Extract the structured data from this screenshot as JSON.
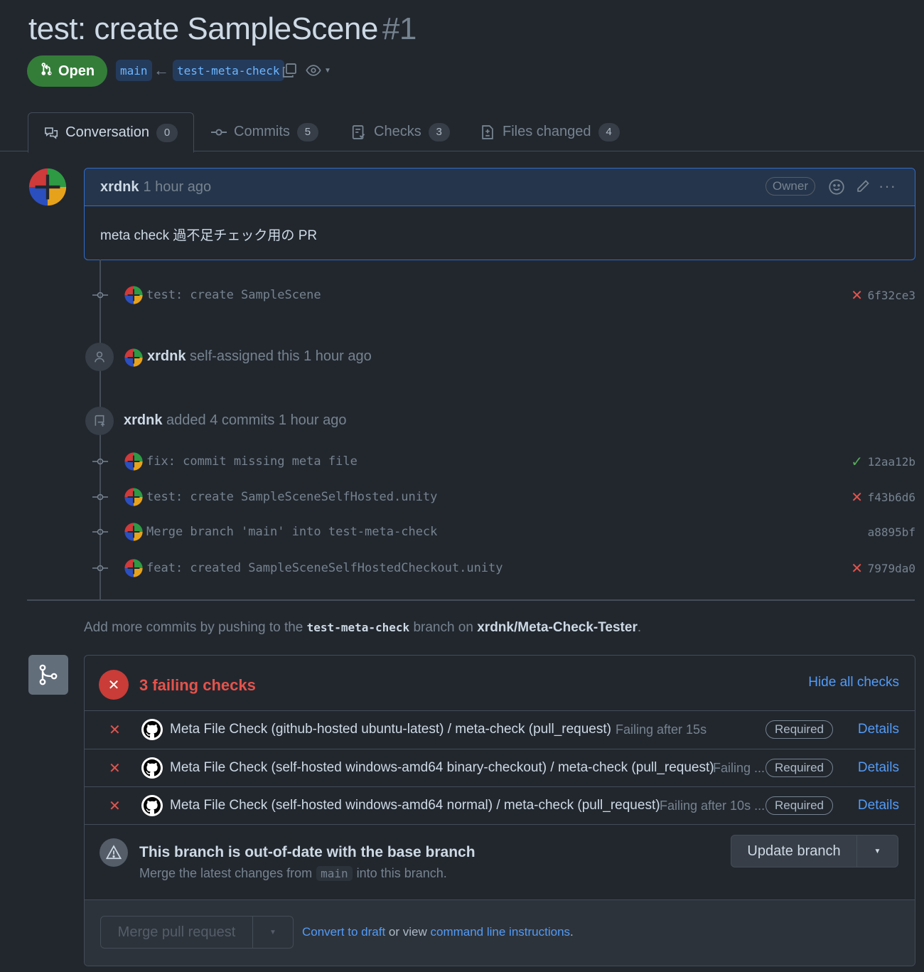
{
  "pr": {
    "title": "test: create SampleScene",
    "number": "#1",
    "state": "Open",
    "base_branch": "main",
    "head_branch": "test-meta-check"
  },
  "tabs": [
    {
      "label": "Conversation",
      "count": "0"
    },
    {
      "label": "Commits",
      "count": "5"
    },
    {
      "label": "Checks",
      "count": "3"
    },
    {
      "label": "Files changed",
      "count": "4"
    }
  ],
  "comment": {
    "author": "xrdnk",
    "time": "1 hour ago",
    "badge": "Owner",
    "body": "meta check 過不足チェック用の PR"
  },
  "timeline": {
    "first_commit": {
      "message": "test: create SampleScene",
      "sha": "6f32ce3",
      "status": "fail"
    },
    "self_assign": {
      "user": "xrdnk",
      "text": "self-assigned this 1 hour ago"
    },
    "added": {
      "user": "xrdnk",
      "text": "added 4 commits 1 hour ago"
    },
    "commits": [
      {
        "message": "fix: commit missing meta file",
        "sha": "12aa12b",
        "status": "ok"
      },
      {
        "message": "test: create SampleSceneSelfHosted.unity",
        "sha": "f43b6d6",
        "status": "fail"
      },
      {
        "message": "Merge branch 'main' into test-meta-check",
        "sha": "a8895bf",
        "status": "none"
      },
      {
        "message": "feat: created SampleSceneSelfHostedCheckout.unity",
        "sha": "7979da0",
        "status": "fail"
      }
    ]
  },
  "push_hint": {
    "prefix": "Add more commits by pushing to the",
    "branch": "test-meta-check",
    "middle": "branch on",
    "repo": "xrdnk/Meta-Check-Tester",
    "suffix": "."
  },
  "checks": {
    "summary": "3 failing checks",
    "hide_label": "Hide all checks",
    "required_label": "Required",
    "details_label": "Details",
    "items": [
      {
        "name": "Meta File Check (github-hosted ubuntu-latest) / meta-check (pull_request)",
        "status": "Failing after 15s"
      },
      {
        "name": "Meta File Check (self-hosted windows-amd64 binary-checkout) / meta-check (pull_request)",
        "status": "Failing ..."
      },
      {
        "name": "Meta File Check (self-hosted windows-amd64 normal) / meta-check (pull_request)",
        "status": "Failing after 10s ..."
      }
    ]
  },
  "outdated": {
    "title": "This branch is out-of-date with the base branch",
    "desc_prefix": "Merge the latest changes from",
    "desc_branch": "main",
    "desc_suffix": "into this branch.",
    "update_label": "Update branch"
  },
  "merge": {
    "button_label": "Merge pull request",
    "draft_link": "Convert to draft",
    "or_view": "or view",
    "cli_link": "command line instructions",
    "end": "."
  }
}
